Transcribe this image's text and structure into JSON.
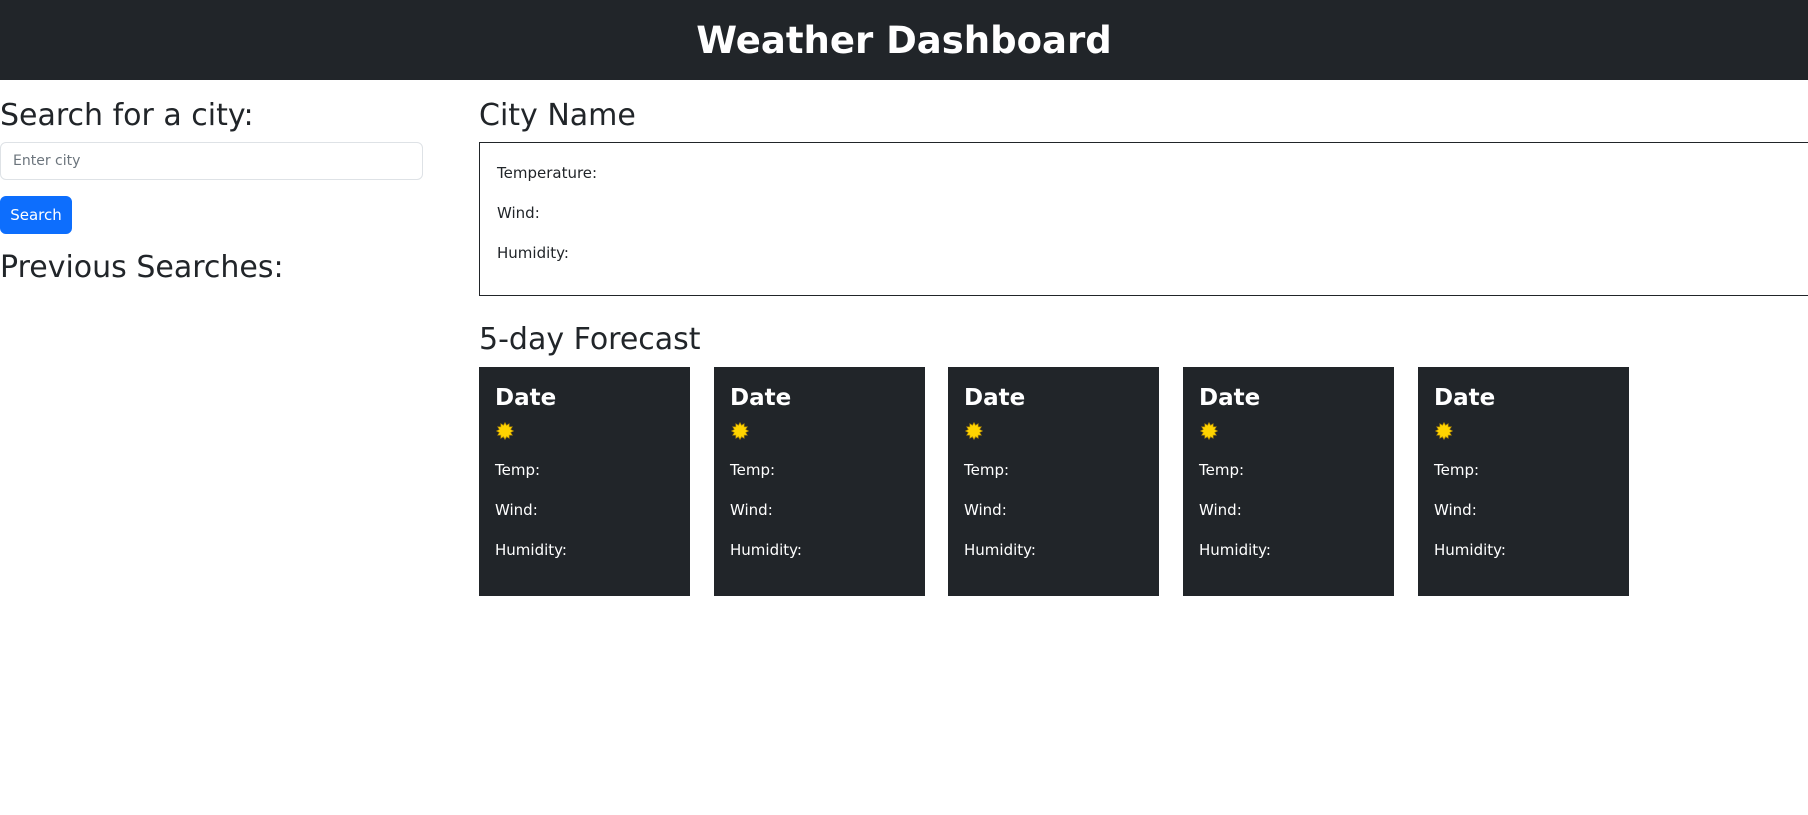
{
  "header": {
    "title": "Weather Dashboard"
  },
  "sidebar": {
    "search_title": "Search for a city:",
    "search_placeholder": "Enter city",
    "search_value": "",
    "search_button": "Search",
    "previous_title": "Previous Searches:"
  },
  "current": {
    "city_name": "City Name",
    "temperature_label": "Temperature:",
    "wind_label": "Wind:",
    "humidity_label": "Humidity:"
  },
  "forecast": {
    "title": "5-day Forecast",
    "days": [
      {
        "date": "Date",
        "icon": "sun-icon",
        "temp": "Temp:",
        "wind": "Wind:",
        "humidity": "Humidity:"
      },
      {
        "date": "Date",
        "icon": "sun-icon",
        "temp": "Temp:",
        "wind": "Wind:",
        "humidity": "Humidity:"
      },
      {
        "date": "Date",
        "icon": "sun-icon",
        "temp": "Temp:",
        "wind": "Wind:",
        "humidity": "Humidity:"
      },
      {
        "date": "Date",
        "icon": "sun-icon",
        "temp": "Temp:",
        "wind": "Wind:",
        "humidity": "Humidity:"
      },
      {
        "date": "Date",
        "icon": "sun-icon",
        "temp": "Temp:",
        "wind": "Wind:",
        "humidity": "Humidity:"
      }
    ]
  },
  "colors": {
    "header_bg": "#212529",
    "card_bg": "#212529",
    "primary": "#0d6efd",
    "sun": "#ffd400"
  }
}
